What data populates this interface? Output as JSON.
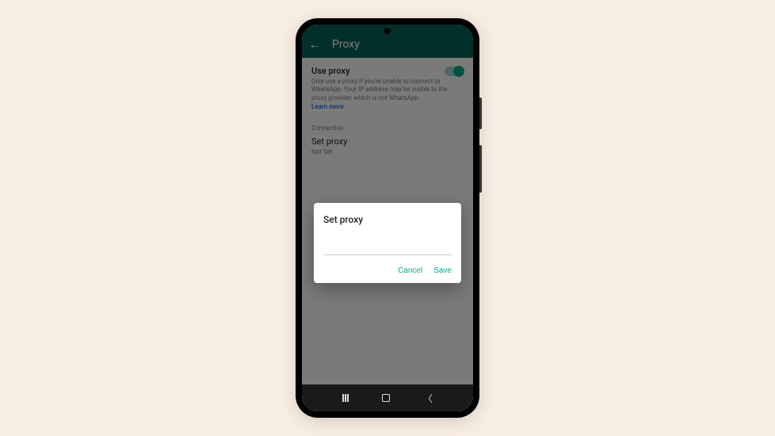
{
  "header": {
    "title": "Proxy"
  },
  "settings": {
    "use_proxy_label": "Use proxy",
    "help_text": "Only use a proxy if you're unable to connect to WhatsApp. Your IP address may be visible to the proxy provider, which is not WhatsApp.",
    "learn_more": "Learn more",
    "connection_label": "Connection",
    "set_proxy_label": "Set proxy",
    "set_proxy_value": "Not Set",
    "toggle_on": true
  },
  "dialog": {
    "title": "Set proxy",
    "input_value": "",
    "cancel_label": "Cancel",
    "save_label": "Save"
  }
}
